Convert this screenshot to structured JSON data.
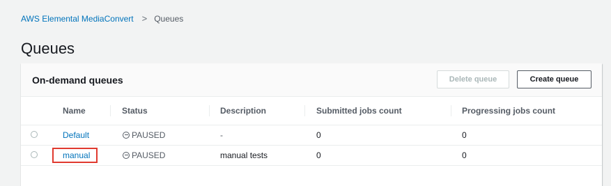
{
  "breadcrumb": {
    "parent": "AWS Elemental MediaConvert",
    "separator": ">",
    "current": "Queues"
  },
  "page": {
    "title": "Queues"
  },
  "panel": {
    "title": "On-demand queues",
    "delete_label": "Delete queue",
    "create_label": "Create queue"
  },
  "table": {
    "headers": {
      "name": "Name",
      "status": "Status",
      "description": "Description",
      "submitted": "Submitted jobs count",
      "progressing": "Progressing jobs count"
    },
    "rows": [
      {
        "name": "Default",
        "status": "PAUSED",
        "description": "-",
        "submitted": "0",
        "progressing": "0"
      },
      {
        "name": "manual",
        "status": "PAUSED",
        "description": "manual tests",
        "submitted": "0",
        "progressing": "0"
      }
    ]
  },
  "icons": {
    "status": "pause-circle-icon",
    "separator": "chevron-right-icon"
  },
  "colors": {
    "link": "#0073bb",
    "highlight": "#e03a2f",
    "background": "#f2f3f3"
  }
}
